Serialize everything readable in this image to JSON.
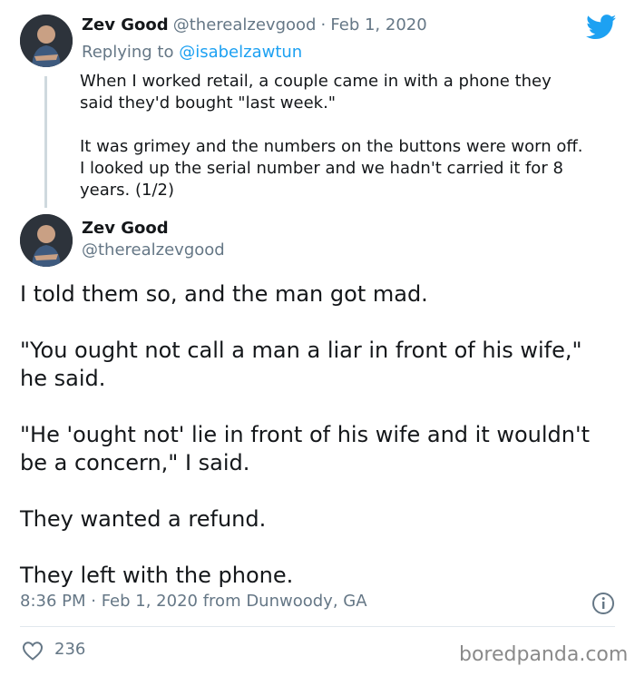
{
  "reply_tweet": {
    "author_name": "Zev Good",
    "author_handle": "@therealzevgood",
    "separator": "·",
    "date": "Feb 1, 2020",
    "replying_prefix": "Replying to",
    "replying_to": "@isabelzawtun",
    "text": "When I worked retail, a couple came in with a phone they\nsaid they'd bought \"last week.\"\n\nIt was grimey and the numbers on the buttons were worn off.\nI looked up the serial number and we hadn't carried it for 8\nyears. (1/2)"
  },
  "main_tweet": {
    "author_name": "Zev Good",
    "author_handle": "@therealzevgood",
    "paragraphs": [
      "I told them so, and the man got mad.",
      "\"You ought not call a man a liar in front of his wife,\" he said.",
      "\"He 'ought not' lie in front of his wife and it wouldn't be a concern,\" I said.",
      "They wanted a refund.",
      "They left with the phone."
    ],
    "timestamp": "8:36 PM · Feb 1, 2020 from Dunwoody, GA",
    "like_count": "236"
  },
  "icons": {
    "brand": "twitter-bird-icon",
    "info": "info-icon",
    "like": "heart-icon"
  },
  "colors": {
    "twitter_blue": "#1da1f2",
    "secondary_text": "#657786",
    "primary_text": "#14171a",
    "divider": "#e1e8ed"
  },
  "watermark": "boredpanda.com"
}
